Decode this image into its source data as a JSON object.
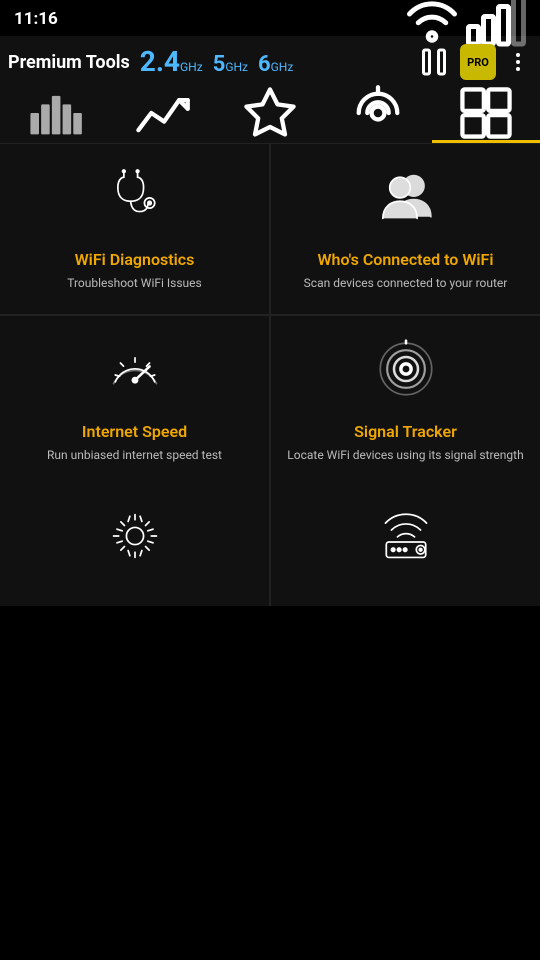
{
  "statusBar": {
    "time": "11:16",
    "wifiIcon": "wifi",
    "signalIcon": "signal"
  },
  "toolbar": {
    "title": "Premium Tools",
    "freq1_num": "2.4",
    "freq1_unit": "GHz",
    "freq2_num": "5",
    "freq2_unit": "GHz",
    "freq3_num": "6",
    "freq3_unit": "GHz",
    "pauseLabel": "⏸",
    "proBadge": "PRO",
    "moreLabel": "⋮"
  },
  "navTabs": [
    {
      "id": "bar-chart",
      "icon": "bars",
      "active": false
    },
    {
      "id": "trend",
      "icon": "trend",
      "active": false
    },
    {
      "id": "star",
      "icon": "star",
      "active": false
    },
    {
      "id": "wifi-radar",
      "icon": "radar",
      "active": false
    },
    {
      "id": "grid",
      "icon": "grid",
      "active": true
    }
  ],
  "grid": [
    {
      "id": "wifi-diagnostics",
      "title": "WiFi Diagnostics",
      "desc": "Troubleshoot WiFi Issues",
      "icon": "stethoscope"
    },
    {
      "id": "whos-connected",
      "title": "Who's Connected to WiFi",
      "desc": "Scan devices connected to your router",
      "icon": "people"
    },
    {
      "id": "internet-speed",
      "title": "Internet Speed",
      "desc": "Run unbiased internet speed test",
      "icon": "speedometer"
    },
    {
      "id": "signal-tracker",
      "title": "Signal Tracker",
      "desc": "Locate WiFi devices using its signal strength",
      "icon": "signal-rings"
    }
  ],
  "bottomRow": [
    {
      "id": "settings",
      "icon": "gear"
    },
    {
      "id": "router-settings",
      "icon": "router-gear"
    }
  ]
}
